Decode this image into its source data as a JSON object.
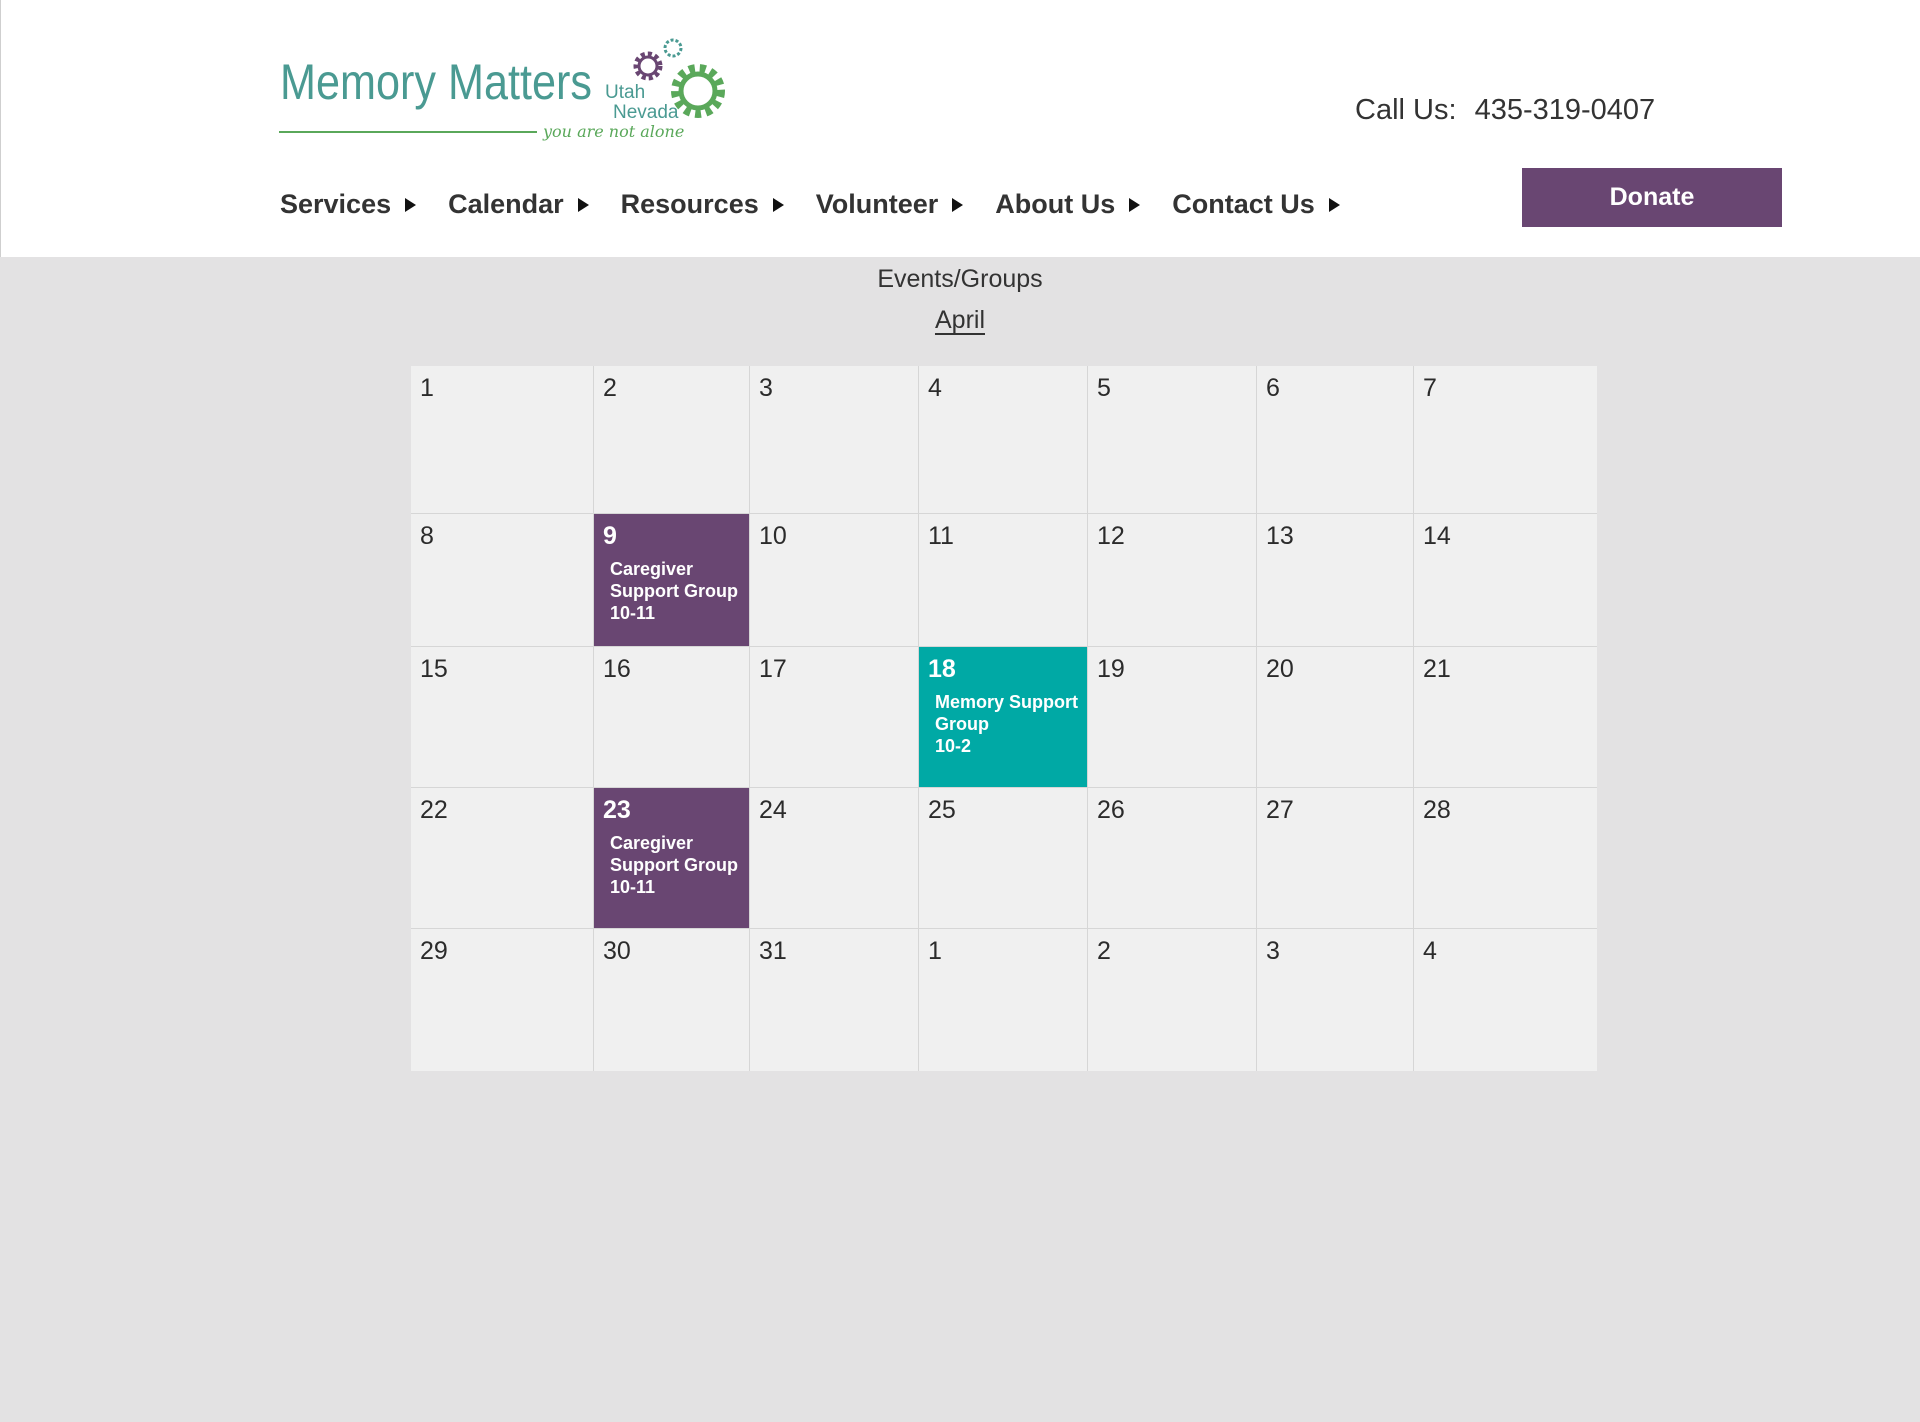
{
  "header": {
    "logo": {
      "title": "Memory Matters",
      "region_line1": "Utah",
      "region_line2": "Nevada",
      "tagline": "you are not alone"
    },
    "phone_label": "Call Us:",
    "phone_number": "435-319-0407",
    "donate_label": "Donate",
    "nav": [
      {
        "label": "Services"
      },
      {
        "label": "Calendar"
      },
      {
        "label": "Resources"
      },
      {
        "label": "Volunteer"
      },
      {
        "label": "About Us"
      },
      {
        "label": "Contact Us"
      }
    ]
  },
  "page": {
    "section_title": "Events/Groups",
    "month": "April"
  },
  "colors": {
    "brand_purple": "#694672",
    "brand_teal": "#00a9a5",
    "logo_green": "#5aa85a",
    "logo_teal": "#4a9a92"
  },
  "calendar": {
    "weeks": [
      [
        {
          "day": "1"
        },
        {
          "day": "2"
        },
        {
          "day": "3"
        },
        {
          "day": "4"
        },
        {
          "day": "5"
        },
        {
          "day": "6"
        },
        {
          "day": "7"
        }
      ],
      [
        {
          "day": "8"
        },
        {
          "day": "9",
          "style": "purple",
          "event": {
            "title_line1": "Caregiver",
            "title_line2": "Support Group",
            "time": "10-11"
          }
        },
        {
          "day": "10"
        },
        {
          "day": "11"
        },
        {
          "day": "12"
        },
        {
          "day": "13"
        },
        {
          "day": "14"
        }
      ],
      [
        {
          "day": "15"
        },
        {
          "day": "16"
        },
        {
          "day": "17"
        },
        {
          "day": "18",
          "style": "teal",
          "event": {
            "title_line1": "Memory Support",
            "title_line2": "Group",
            "time": "10-2"
          }
        },
        {
          "day": "19"
        },
        {
          "day": "20"
        },
        {
          "day": "21"
        }
      ],
      [
        {
          "day": "22"
        },
        {
          "day": "23",
          "style": "purple",
          "event": {
            "title_line1": "Caregiver",
            "title_line2": "Support Group",
            "time": "10-11"
          }
        },
        {
          "day": "24"
        },
        {
          "day": "25"
        },
        {
          "day": "26"
        },
        {
          "day": "27"
        },
        {
          "day": "28"
        }
      ],
      [
        {
          "day": "29"
        },
        {
          "day": "30"
        },
        {
          "day": "31"
        },
        {
          "day": "1"
        },
        {
          "day": "2"
        },
        {
          "day": "3"
        },
        {
          "day": "4"
        }
      ]
    ]
  }
}
